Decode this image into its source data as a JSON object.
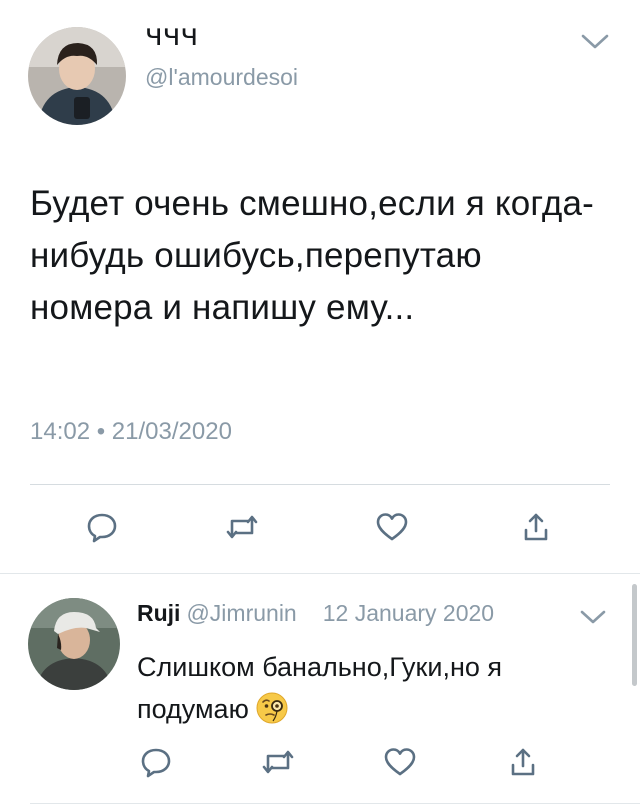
{
  "tweet": {
    "author_name": "ччч",
    "author_handle": "@l'amourdesoi",
    "text": "Будет очень смешно,если я когда-нибудь ошибусь,перепутаю номера и напишу ему...",
    "timestamp": "14:02 • 21/03/2020"
  },
  "reply": {
    "author_name": "Ruji",
    "author_handle": "@Jimrunin",
    "date": "12 January 2020",
    "text": "Слишком банально,Гуки,но я подумаю",
    "emoji": "face-with-monocle"
  },
  "icons": {
    "reply": "speech-bubble-icon",
    "retweet": "retweet-icon",
    "like": "heart-icon",
    "share": "share-icon",
    "menu": "chevron-down-icon"
  },
  "colors": {
    "text": "#14171a",
    "secondary": "#8a9aa7",
    "icon": "#5b7083",
    "divider": "#d6dce0"
  }
}
